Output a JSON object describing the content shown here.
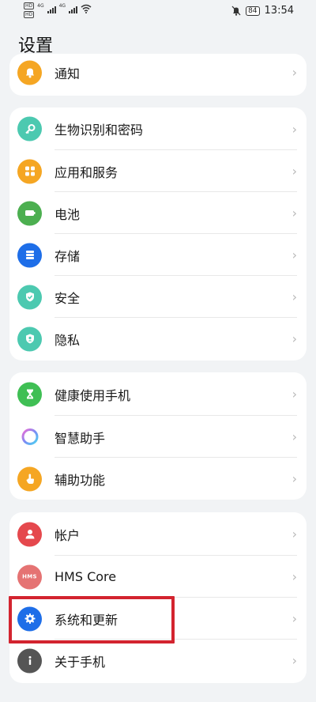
{
  "status_bar": {
    "time": "13:54",
    "battery": "84",
    "network": "4G",
    "hd1": "HD",
    "hd2": "HD"
  },
  "header": {
    "title": "设置"
  },
  "cards": [
    {
      "items": [
        {
          "label": "通知",
          "icon": "bell-icon",
          "color": "#f5a623"
        }
      ]
    },
    {
      "items": [
        {
          "label": "生物识别和密码",
          "icon": "key-icon",
          "color": "#4cc9b0"
        },
        {
          "label": "应用和服务",
          "icon": "apps-icon",
          "color": "#f5a623"
        },
        {
          "label": "电池",
          "icon": "battery-icon",
          "color": "#4caf50"
        },
        {
          "label": "存储",
          "icon": "storage-icon",
          "color": "#1e6ee8"
        },
        {
          "label": "安全",
          "icon": "shield-check-icon",
          "color": "#4cc9b0"
        },
        {
          "label": "隐私",
          "icon": "privacy-shield-icon",
          "color": "#4cc9b0"
        }
      ]
    },
    {
      "items": [
        {
          "label": "健康使用手机",
          "icon": "hourglass-icon",
          "color": "#3fbf54"
        },
        {
          "label": "智慧助手",
          "icon": "assistant-ring-icon",
          "color": "#ffffff"
        },
        {
          "label": "辅助功能",
          "icon": "hand-pointer-icon",
          "color": "#f5a623"
        }
      ]
    },
    {
      "items": [
        {
          "label": "帐户",
          "icon": "user-icon",
          "color": "#e5484d"
        },
        {
          "label": "HMS Core",
          "icon": "hms-icon",
          "color": "#e57373",
          "badge": "HMS"
        },
        {
          "label": "系统和更新",
          "icon": "gear-icon",
          "color": "#1e6ee8"
        },
        {
          "label": "关于手机",
          "icon": "info-icon",
          "color": "#555555"
        }
      ]
    }
  ],
  "chevron": "›"
}
